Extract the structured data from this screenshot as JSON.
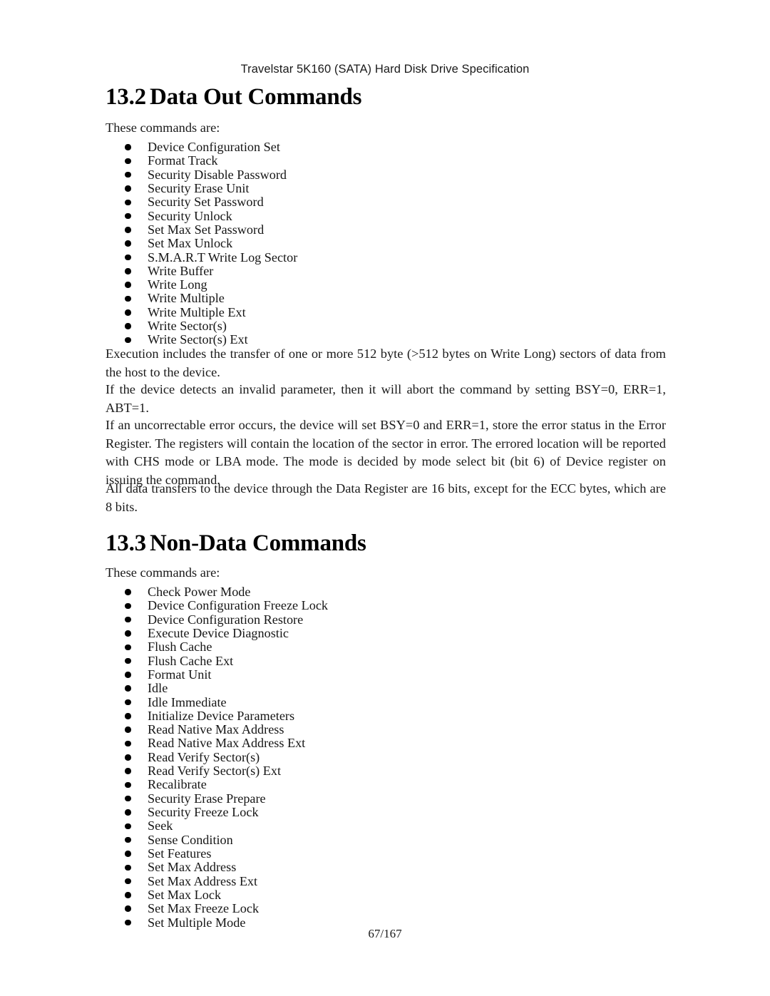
{
  "header": {
    "running_title": "Travelstar 5K160 (SATA) Hard Disk Drive Specification"
  },
  "footer": {
    "page_number": "67/167"
  },
  "sections": [
    {
      "number": "13.2",
      "title": "Data Out Commands",
      "lead_in": "These commands are:",
      "commands": [
        "Device Configuration Set",
        "Format Track",
        "Security Disable Password",
        "Security Erase Unit",
        "Security Set Password",
        "Security Unlock",
        "Set Max Set Password",
        "Set Max Unlock",
        "S.M.A.R.T Write Log Sector",
        "Write Buffer",
        "Write Long",
        "Write Multiple",
        "Write Multiple Ext",
        "Write Sector(s)",
        "Write Sector(s) Ext"
      ],
      "paragraphs": [
        "Execution includes the transfer of one or more 512 byte (>512 bytes on Write Long) sectors of data from the host to the device.",
        "If the device detects an invalid parameter, then it will abort the command by setting BSY=0, ERR=1, ABT=1.",
        "If an uncorrectable error occurs, the device will set BSY=0 and ERR=1, store the error status in the Error Register. The registers will contain the location of the sector in error. The errored location will be reported with CHS mode or LBA mode. The mode is decided by mode select bit (bit 6) of Device register on issuing the command.",
        "All data transfers to the device through the Data Register are 16 bits, except for the ECC bytes, which are 8 bits."
      ]
    },
    {
      "number": "13.3",
      "title": "Non-Data Commands",
      "lead_in": "These commands are:",
      "commands": [
        "Check Power Mode",
        "Device Configuration Freeze Lock",
        "Device Configuration Restore",
        "Execute Device Diagnostic",
        "Flush Cache",
        "Flush Cache Ext",
        "Format Unit",
        "Idle",
        "Idle Immediate",
        "Initialize Device Parameters",
        "Read Native Max Address",
        "Read Native Max Address Ext",
        "Read Verify Sector(s)",
        "Read Verify Sector(s) Ext",
        "Recalibrate",
        "Security Erase Prepare",
        "Security Freeze Lock",
        "Seek",
        "Sense Condition",
        "Set Features",
        "Set Max Address",
        "Set Max Address Ext",
        "Set Max Lock",
        "Set Max Freeze Lock",
        "Set Multiple Mode"
      ],
      "paragraphs": []
    }
  ],
  "colors": {
    "page_background": "#ffffff",
    "text": "#000000",
    "bullet": "#000000"
  }
}
